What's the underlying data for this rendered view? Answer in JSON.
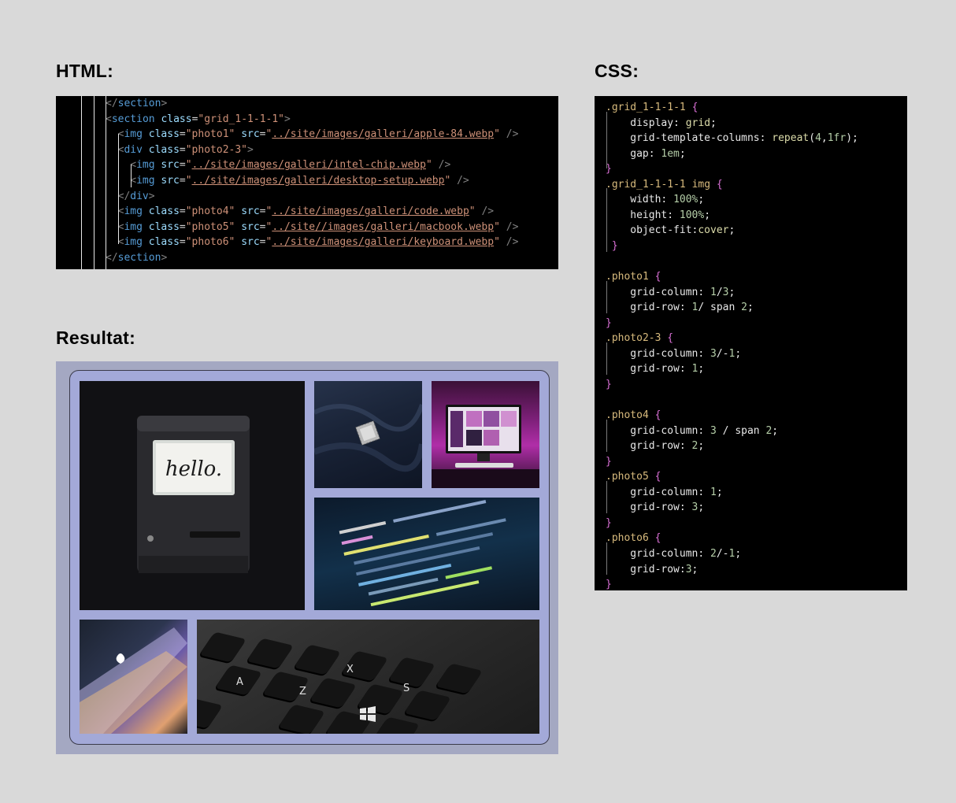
{
  "headings": {
    "html": "HTML:",
    "css": "CSS:",
    "result": "Resultat:"
  },
  "html_code": [
    [
      [
        "t-punct",
        "</"
      ],
      [
        "t-tag",
        "section"
      ],
      [
        "t-punct",
        ">"
      ]
    ],
    [
      [
        "t-punct",
        "<"
      ],
      [
        "t-tag",
        "section"
      ],
      [
        "t-plain",
        " "
      ],
      [
        "t-attr",
        "class"
      ],
      [
        "t-plain",
        "="
      ],
      [
        "t-str",
        "\"grid_1-1-1-1\""
      ],
      [
        "t-punct",
        ">"
      ]
    ],
    [
      [
        "t-punct",
        "<"
      ],
      [
        "t-tag",
        "img"
      ],
      [
        "t-plain",
        " "
      ],
      [
        "t-attr",
        "class"
      ],
      [
        "t-plain",
        "="
      ],
      [
        "t-str",
        "\"photo1\""
      ],
      [
        "t-plain",
        " "
      ],
      [
        "t-attr",
        "src"
      ],
      [
        "t-plain",
        "="
      ],
      [
        "t-str",
        "\""
      ],
      [
        "t-link",
        "../site/images/galleri/apple-84.webp"
      ],
      [
        "t-str",
        "\""
      ],
      [
        "t-plain",
        " "
      ],
      [
        "t-punct",
        "/>"
      ]
    ],
    [
      [
        "t-punct",
        "<"
      ],
      [
        "t-tag",
        "div"
      ],
      [
        "t-plain",
        " "
      ],
      [
        "t-attr",
        "class"
      ],
      [
        "t-plain",
        "="
      ],
      [
        "t-str",
        "\"photo2-3\""
      ],
      [
        "t-punct",
        ">"
      ]
    ],
    [
      [
        "t-punct",
        "<"
      ],
      [
        "t-tag",
        "img"
      ],
      [
        "t-plain",
        " "
      ],
      [
        "t-attr",
        "src"
      ],
      [
        "t-plain",
        "="
      ],
      [
        "t-str",
        "\""
      ],
      [
        "t-link",
        "../site/images/galleri/intel-chip.webp"
      ],
      [
        "t-str",
        "\""
      ],
      [
        "t-plain",
        " "
      ],
      [
        "t-punct",
        "/>"
      ]
    ],
    [
      [
        "t-punct",
        "<"
      ],
      [
        "t-tag",
        "img"
      ],
      [
        "t-plain",
        " "
      ],
      [
        "t-attr",
        "src"
      ],
      [
        "t-plain",
        "="
      ],
      [
        "t-str",
        "\""
      ],
      [
        "t-link",
        "../site/images/galleri/desktop-setup.webp"
      ],
      [
        "t-str",
        "\""
      ],
      [
        "t-plain",
        " "
      ],
      [
        "t-punct",
        "/>"
      ]
    ],
    [
      [
        "t-punct",
        "</"
      ],
      [
        "t-tag",
        "div"
      ],
      [
        "t-punct",
        ">"
      ]
    ],
    [
      [
        "t-punct",
        "<"
      ],
      [
        "t-tag",
        "img"
      ],
      [
        "t-plain",
        " "
      ],
      [
        "t-attr",
        "class"
      ],
      [
        "t-plain",
        "="
      ],
      [
        "t-str",
        "\"photo4\""
      ],
      [
        "t-plain",
        " "
      ],
      [
        "t-attr",
        "src"
      ],
      [
        "t-plain",
        "="
      ],
      [
        "t-str",
        "\""
      ],
      [
        "t-link",
        "../site/images/galleri/code.webp"
      ],
      [
        "t-str",
        "\""
      ],
      [
        "t-plain",
        " "
      ],
      [
        "t-punct",
        "/>"
      ]
    ],
    [
      [
        "t-punct",
        "<"
      ],
      [
        "t-tag",
        "img"
      ],
      [
        "t-plain",
        " "
      ],
      [
        "t-attr",
        "class"
      ],
      [
        "t-plain",
        "="
      ],
      [
        "t-str",
        "\"photo5\""
      ],
      [
        "t-plain",
        " "
      ],
      [
        "t-attr",
        "src"
      ],
      [
        "t-plain",
        "="
      ],
      [
        "t-str",
        "\""
      ],
      [
        "t-link",
        "../site//images/galleri/macbook.webp"
      ],
      [
        "t-str",
        "\""
      ],
      [
        "t-plain",
        " "
      ],
      [
        "t-punct",
        "/>"
      ]
    ],
    [
      [
        "t-punct",
        "<"
      ],
      [
        "t-tag",
        "img"
      ],
      [
        "t-plain",
        " "
      ],
      [
        "t-attr",
        "class"
      ],
      [
        "t-plain",
        "="
      ],
      [
        "t-str",
        "\"photo6\""
      ],
      [
        "t-plain",
        " "
      ],
      [
        "t-attr",
        "src"
      ],
      [
        "t-plain",
        "="
      ],
      [
        "t-str",
        "\""
      ],
      [
        "t-link",
        "../site/images/galleri/keyboard.webp"
      ],
      [
        "t-str",
        "\""
      ],
      [
        "t-plain",
        " "
      ],
      [
        "t-punct",
        "/>"
      ]
    ],
    [
      [
        "t-punct",
        "</"
      ],
      [
        "t-tag",
        "section"
      ],
      [
        "t-punct",
        ">"
      ]
    ]
  ],
  "css_code": [
    [
      [
        "c-sel",
        ".grid_1-1-1-1"
      ],
      [
        "c-prop",
        " "
      ],
      [
        "c-brace",
        "{"
      ]
    ],
    [
      [
        "c-prop",
        "display: "
      ],
      [
        "c-val",
        "grid"
      ],
      [
        "c-prop",
        ";"
      ]
    ],
    [
      [
        "c-prop",
        "grid-template-columns: "
      ],
      [
        "c-val",
        "repeat"
      ],
      [
        "c-prop",
        "("
      ],
      [
        "c-num",
        "4"
      ],
      [
        "c-prop",
        ","
      ],
      [
        "c-num",
        "1fr"
      ],
      [
        "c-prop",
        ");"
      ]
    ],
    [
      [
        "c-prop",
        "gap: "
      ],
      [
        "c-num",
        "1em"
      ],
      [
        "c-prop",
        ";"
      ]
    ],
    [
      [
        "c-brace",
        "}"
      ]
    ],
    [
      [
        "c-sel",
        ".grid_1-1-1-1 img"
      ],
      [
        "c-prop",
        " "
      ],
      [
        "c-brace",
        "{"
      ]
    ],
    [
      [
        "c-prop",
        "width: "
      ],
      [
        "c-num",
        "100%"
      ],
      [
        "c-prop",
        ";"
      ]
    ],
    [
      [
        "c-prop",
        "height: "
      ],
      [
        "c-num",
        "100%"
      ],
      [
        "c-prop",
        ";"
      ]
    ],
    [
      [
        "c-prop",
        "object-fit:"
      ],
      [
        "c-val",
        "cover"
      ],
      [
        "c-prop",
        ";"
      ]
    ],
    [
      [
        "c-brace",
        "}"
      ]
    ],
    [],
    [
      [
        "c-sel",
        ".photo1"
      ],
      [
        "c-prop",
        " "
      ],
      [
        "c-brace",
        "{"
      ]
    ],
    [
      [
        "c-prop",
        "grid-column: "
      ],
      [
        "c-num",
        "1"
      ],
      [
        "c-prop",
        "/"
      ],
      [
        "c-num",
        "3"
      ],
      [
        "c-prop",
        ";"
      ]
    ],
    [
      [
        "c-prop",
        "grid-row: "
      ],
      [
        "c-num",
        "1"
      ],
      [
        "c-prop",
        "/ span "
      ],
      [
        "c-num",
        "2"
      ],
      [
        "c-prop",
        ";"
      ]
    ],
    [
      [
        "c-brace",
        "}"
      ]
    ],
    [
      [
        "c-sel",
        ".photo2-3"
      ],
      [
        "c-prop",
        " "
      ],
      [
        "c-brace",
        "{"
      ]
    ],
    [
      [
        "c-prop",
        "grid-column: "
      ],
      [
        "c-num",
        "3"
      ],
      [
        "c-prop",
        "/-"
      ],
      [
        "c-num",
        "1"
      ],
      [
        "c-prop",
        ";"
      ]
    ],
    [
      [
        "c-prop",
        "grid-row: "
      ],
      [
        "c-num",
        "1"
      ],
      [
        "c-prop",
        ";"
      ]
    ],
    [
      [
        "c-brace",
        "}"
      ]
    ],
    [],
    [
      [
        "c-sel",
        ".photo4"
      ],
      [
        "c-prop",
        " "
      ],
      [
        "c-brace",
        "{"
      ]
    ],
    [
      [
        "c-prop",
        "grid-column: "
      ],
      [
        "c-num",
        "3"
      ],
      [
        "c-prop",
        " / span "
      ],
      [
        "c-num",
        "2"
      ],
      [
        "c-prop",
        ";"
      ]
    ],
    [
      [
        "c-prop",
        "grid-row: "
      ],
      [
        "c-num",
        "2"
      ],
      [
        "c-prop",
        ";"
      ]
    ],
    [
      [
        "c-brace",
        "}"
      ]
    ],
    [
      [
        "c-sel",
        ".photo5"
      ],
      [
        "c-prop",
        " "
      ],
      [
        "c-brace",
        "{"
      ]
    ],
    [
      [
        "c-prop",
        "grid-column: "
      ],
      [
        "c-num",
        "1"
      ],
      [
        "c-prop",
        ";"
      ]
    ],
    [
      [
        "c-prop",
        "grid-row: "
      ],
      [
        "c-num",
        "3"
      ],
      [
        "c-prop",
        ";"
      ]
    ],
    [
      [
        "c-brace",
        "}"
      ]
    ],
    [
      [
        "c-sel",
        ".photo6"
      ],
      [
        "c-prop",
        " "
      ],
      [
        "c-brace",
        "{"
      ]
    ],
    [
      [
        "c-prop",
        "grid-column: "
      ],
      [
        "c-num",
        "2"
      ],
      [
        "c-prop",
        "/-"
      ],
      [
        "c-num",
        "1"
      ],
      [
        "c-prop",
        ";"
      ]
    ],
    [
      [
        "c-prop",
        "grid-row:"
      ],
      [
        "c-num",
        "3"
      ],
      [
        "c-prop",
        ";"
      ]
    ],
    [
      [
        "c-brace",
        "}"
      ]
    ]
  ],
  "photos": {
    "hello_text": "hello.",
    "keyboard_keys": [
      "A",
      "Z",
      "X",
      "S"
    ]
  }
}
